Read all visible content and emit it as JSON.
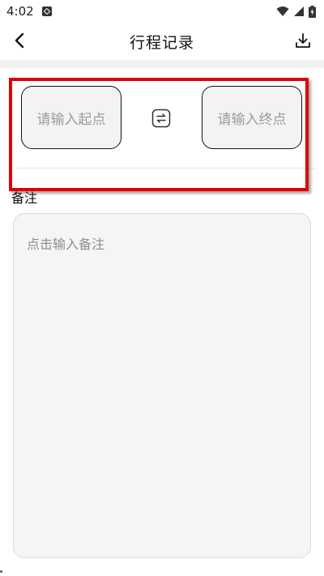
{
  "status_bar": {
    "time": "4:02",
    "icons": [
      "notification-app-icon",
      "wifi-icon",
      "cellular-signal-icon",
      "battery-icon"
    ]
  },
  "header": {
    "title": "行程记录",
    "back_icon": "chevron-left-icon",
    "download_icon": "download-icon"
  },
  "route": {
    "start_placeholder": "请输入起点",
    "end_placeholder": "请输入终点",
    "swap_icon": "swap-icon"
  },
  "note": {
    "label": "备注",
    "placeholder": "点击输入备注"
  },
  "colors": {
    "highlight": "#e00000",
    "input_bg": "#f3f3f3",
    "placeholder": "#9b9b9b"
  }
}
